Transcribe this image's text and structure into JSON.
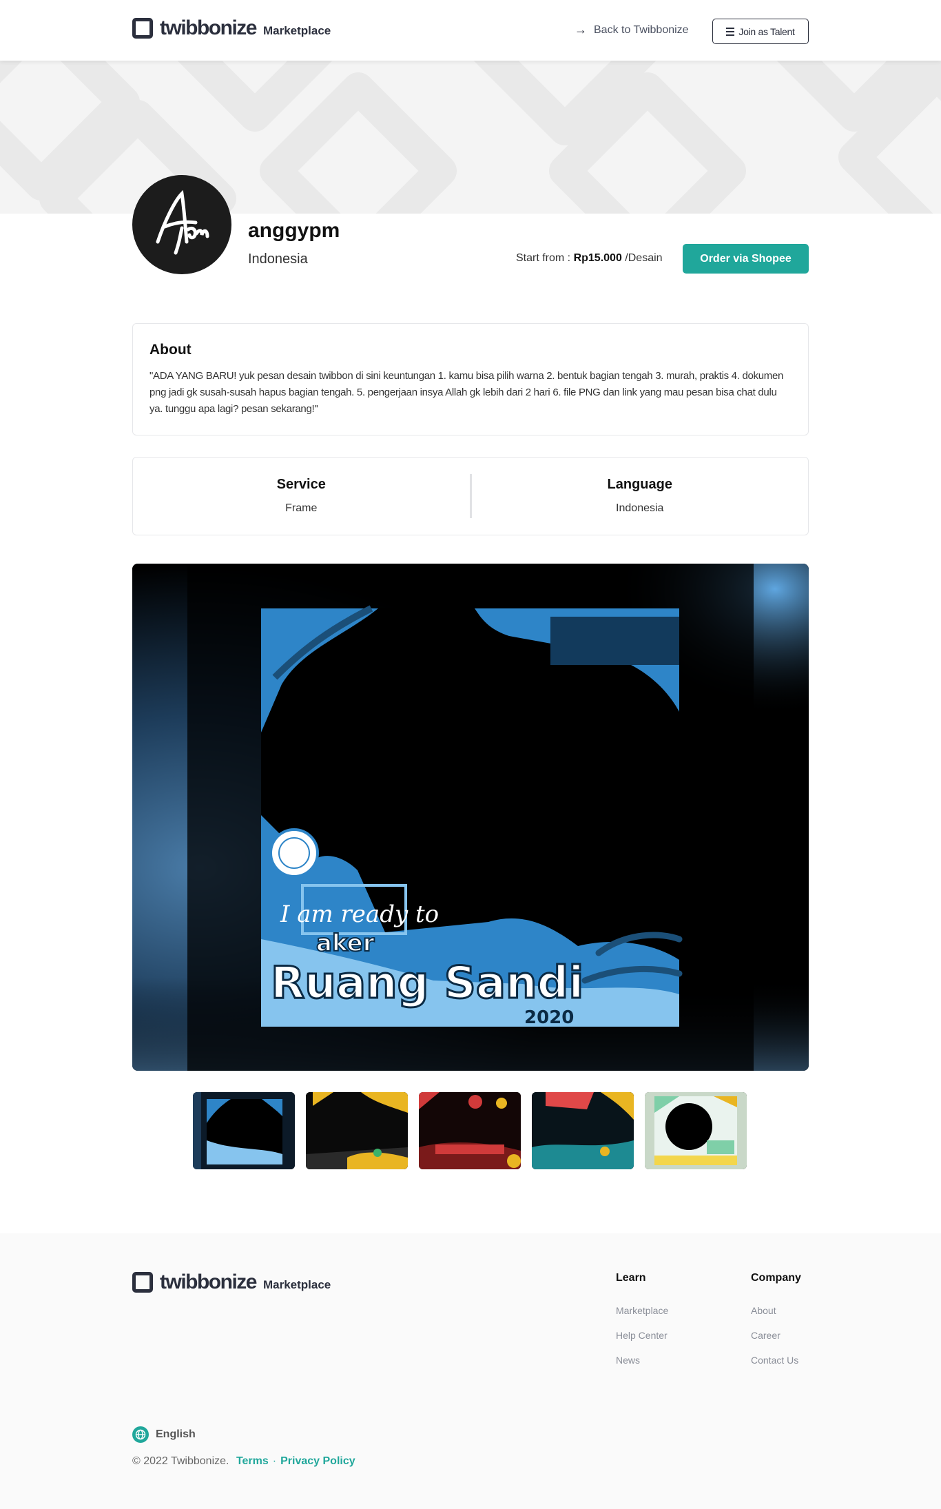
{
  "header": {
    "logo_word": "twibbonize",
    "logo_sub": "Marketplace",
    "back_label": "Back to Twibbonize",
    "join_label": "Join as Talent"
  },
  "profile": {
    "username": "anggypm",
    "country": "Indonesia",
    "price_prefix": "Start from : ",
    "price_value": "Rp15.000",
    "price_suffix": " /Desain",
    "order_label": "Order via Shopee"
  },
  "about": {
    "title": "About",
    "text": "\"ADA YANG BARU! yuk pesan desain twibbon di sini keuntungan 1. kamu bisa pilih warna 2. bentuk bagian tengah 3. murah, praktis 4. dokumen png jadi gk susah-susah hapus bagian tengah. 5. pengerjaan insya Allah gk lebih dari 2 hari 6. file PNG dan link yang mau pesan bisa chat dulu ya. tunggu apa lagi? pesan sekarang!\""
  },
  "info": {
    "service_title": "Service",
    "service_value": "Frame",
    "language_title": "Language",
    "language_value": "Indonesia"
  },
  "preview": {
    "line1": "I am ready to",
    "line2": "aker",
    "line3": "Ruang Sandi",
    "year": "2020"
  },
  "thumbnails": [
    {
      "name": "thumb-ruang-sandi",
      "accent": "#3b8fd0"
    },
    {
      "name": "thumb-puskesmas-yellow",
      "accent": "#e9b522"
    },
    {
      "name": "thumb-upt-puskesmas",
      "accent": "#d03a3a"
    },
    {
      "name": "thumb-puskesmas-red",
      "accent": "#e04848"
    },
    {
      "name": "thumb-mts",
      "accent": "#7fcfa8"
    }
  ],
  "footer": {
    "learn_title": "Learn",
    "learn_links": [
      "Marketplace",
      "Help Center",
      "News"
    ],
    "company_title": "Company",
    "company_links": [
      "About",
      "Career",
      "Contact Us"
    ],
    "language": "English",
    "copyright": "© 2022 Twibbonize.",
    "terms": "Terms",
    "privacy": "Privacy Policy"
  },
  "colors": {
    "accent": "#20a79b",
    "dark": "#2b2f3d"
  }
}
